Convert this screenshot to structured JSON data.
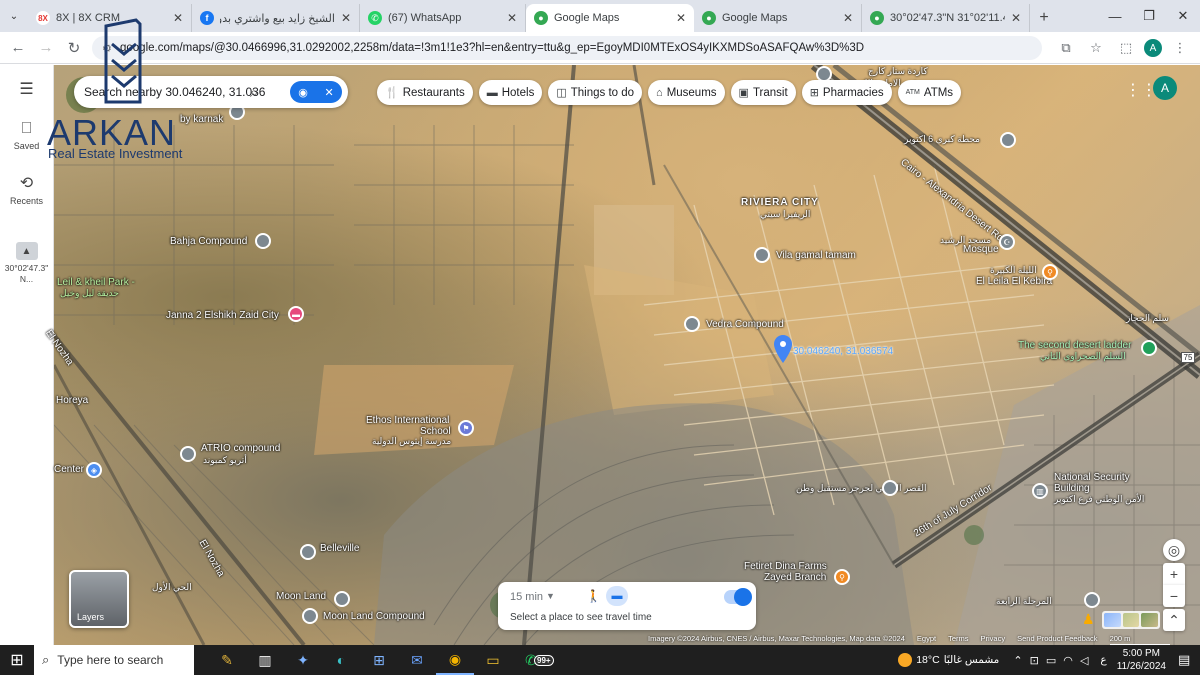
{
  "browser": {
    "tabs": [
      {
        "title": "8X | 8X CRM",
        "favicon": "8x-logo-icon",
        "active": false
      },
      {
        "title": "الشيخ زايد بيع واشتري بدون و...",
        "favicon": "facebook-icon",
        "active": false
      },
      {
        "title": "(67) WhatsApp",
        "favicon": "whatsapp-icon",
        "active": false
      },
      {
        "title": "Google Maps",
        "favicon": "google-maps-icon",
        "active": true
      },
      {
        "title": "Google Maps",
        "favicon": "google-maps-icon",
        "active": false
      },
      {
        "title": "30°02'47.3\"N 31°02'11.4\"E -",
        "favicon": "google-maps-icon",
        "active": false
      }
    ],
    "url": "google.com/maps/@30.0466996,31.0292002,2258m/data=!3m1!1e3?hl=en&entry=ttu&g_ep=EgoyMDI0MTExOS4yIKXMDSoASAFQAw%3D%3D",
    "profile_initial": "A"
  },
  "logo": {
    "name": "ARKAN",
    "tagline": "Real Estate Investment"
  },
  "rail": {
    "saved": "Saved",
    "recents": "Recents",
    "recent_place": "30°02'47.3\" N..."
  },
  "search": {
    "value": "Search nearby 30.046240, 31.036"
  },
  "chips": [
    {
      "label": "Restaurants",
      "icon": "fork-knife-icon"
    },
    {
      "label": "Hotels",
      "icon": "bed-icon"
    },
    {
      "label": "Things to do",
      "icon": "camera-icon"
    },
    {
      "label": "Museums",
      "icon": "museum-icon"
    },
    {
      "label": "Transit",
      "icon": "train-icon"
    },
    {
      "label": "Pharmacies",
      "icon": "pharmacy-icon"
    },
    {
      "label": "ATMs",
      "icon": "atm-icon"
    }
  ],
  "map_labels": {
    "karnak": "by karnak",
    "bahja": "Bahja Compound",
    "leil_kheil": "Leil & kheil Park -",
    "leil_kheil_ar": "حديقة ليل وخيل",
    "janna": "Janna 2 Elshikh Zaid City",
    "el_nozha_left": "El Nozha",
    "horeya": "Horeya",
    "center": "Center",
    "atrio": "ATRIO compound",
    "atrio_ar": "أتريو كمبوند",
    "ethos_1": "Ethos International",
    "ethos_2": "School",
    "ethos_ar": "مدرسة إيثوس الدولية",
    "el_nozha_bottom": "El Nozha",
    "belleville": "Belleville",
    "moon_land_1": "Moon Land",
    "moon_land_compound": "Moon Land Compound",
    "el_hay_alawal": "الحي الأول",
    "riviera": "RIVIERA CITY",
    "riviera_ar": "الريفيرا سيتي",
    "vila_gamal": "Vila gamal tamam",
    "vedra": "Vedra Compound",
    "coords": "30.046240, 31.036574",
    "cairo_alex": "Cairo - Alexandria Desert Rd",
    "mahata": "محطة كبري 6 اكتوبر",
    "mosque_ar": "مسجد الرشيد",
    "mosque": "Mosque",
    "leila_kebira_ar": "الليلة الكبيرة",
    "leila_kebira": "El Leila El Kebira",
    "second_ladder_ar": "سلم الحجاز",
    "second_ladder": "The second desert ladder",
    "second_ladder_ar2": "السلم الصحراوي الثاني",
    "road_badge": "75",
    "national_1": "National Security",
    "national_2": "Building",
    "national_ar": "الأمن الوطني فرع اكتوبر",
    "corridor": "26th of July Corridor",
    "fetiret_1": "Fetiret Dina Farms",
    "fetiret_2": "Zayed Branch",
    "fetiret_ar": "فطيرة دينا فارم الشيخ زايد",
    "qasr_ar": "القصر الملكي لجرجر مستقبل وطن",
    "marhala_ar": "المرحلة الرابعة",
    "top_ar": "كاردة ستار كارج",
    "top_ar2": "ش - الامام فالك"
  },
  "travel": {
    "time": "15 min",
    "hint": "Select a place to see travel time"
  },
  "layers_label": "Layers",
  "attribution": {
    "imagery": "Imagery ©2024 Airbus, CNES / Airbus, Maxar Technologies, Map data ©2024",
    "egypt": "Egypt",
    "terms": "Terms",
    "privacy": "Privacy",
    "feedback": "Send Product Feedback",
    "scale": "200 m"
  },
  "taskbar": {
    "search_placeholder": "Type here to search",
    "whatsapp_badge": "99+",
    "temperature": "18°C",
    "weather": "مشمس غالبًا",
    "time": "5:00 PM",
    "date": "11/26/2024",
    "lang": "ع"
  }
}
